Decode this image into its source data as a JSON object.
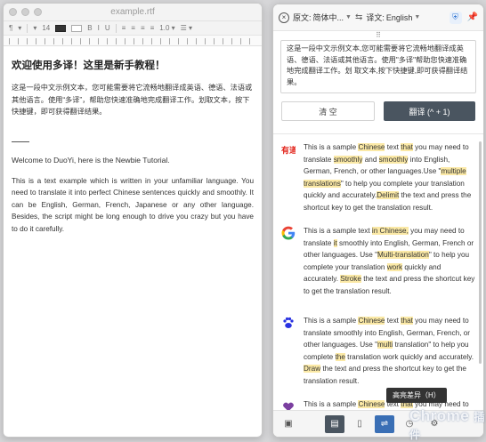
{
  "editor": {
    "filename": "example.rtf",
    "toolbar": {
      "paragraph_style": "¶",
      "font_size": "14"
    },
    "content": {
      "zh_title": "欢迎使用多译！这里是新手教程！",
      "zh_paragraph": "这是一段中文示例文本，您可能需要将它流畅地翻译成英语、德语、法语或其他语言。使用“多译”，帮助您快速准确地完成翻译工作。划取文本，按下快捷键，即可获得翻译结果。",
      "en_title": "Welcome to DuoYi, here is the Newbie Tutorial.",
      "en_paragraph": "This is a text example which is written in your unfamiliar language. You need to translate it into perfect Chinese sentences quickly and smoothly. It can be English, German, French, Japanese or any other language. Besides, the script might be long enough to drive you crazy but you have to do it carefully."
    }
  },
  "translator": {
    "source_label": "原文:",
    "source_value": "简体中...",
    "target_label": "译文:",
    "target_value": "English",
    "input_text": "这是一段中文示例文本,您可能需要将它流畅地翻译成英语、德语、法语或其他语言。使用\"多译\"帮助您快速准确地完成翻译工作。划 取文本,按下快捷键,即可获得翻译结果。",
    "clear_label": "清 空",
    "translate_label": "翻译 (^ + 1)",
    "results": [
      {
        "engine": "youdao-icon",
        "segments": [
          [
            "This is a sample ",
            false
          ],
          [
            "Chinese",
            true
          ],
          [
            " text ",
            false
          ],
          [
            "that",
            true
          ],
          [
            " you may need to translate ",
            false
          ],
          [
            "smoothly",
            true
          ],
          [
            " and ",
            false
          ],
          [
            "smoothly",
            true
          ],
          [
            " into English, German, French, or other languages.Use \"",
            false
          ],
          [
            "multiple translations",
            true
          ],
          [
            "\" to help you complete your translation quickly and accurately.",
            false
          ],
          [
            "Delimit",
            true
          ],
          [
            " the text and press the shortcut key to get the translation result.",
            false
          ]
        ]
      },
      {
        "engine": "google-icon",
        "segments": [
          [
            "This is a sample text ",
            false
          ],
          [
            "in Chinese,",
            true
          ],
          [
            " you may need to translate ",
            false
          ],
          [
            "it",
            true
          ],
          [
            " smoothly into English, German, French or other languages. Use \"",
            false
          ],
          [
            "Multi-translation",
            true
          ],
          [
            "\" to help you complete your translation ",
            false
          ],
          [
            "work",
            true
          ],
          [
            " quickly and accurately. ",
            false
          ],
          [
            "Stroke",
            true
          ],
          [
            " the text and press the shortcut key to get the translation result.",
            false
          ]
        ]
      },
      {
        "engine": "baidu-icon",
        "segments": [
          [
            "This is a sample ",
            false
          ],
          [
            "Chinese",
            true
          ],
          [
            " text ",
            false
          ],
          [
            "that",
            true
          ],
          [
            " you may need to translate smoothly into English, German, French, or other languages. Use \"",
            false
          ],
          [
            "multi",
            true
          ],
          [
            " translation\" to help you complete ",
            false
          ],
          [
            "the",
            true
          ],
          [
            " translation work quickly and accurately. ",
            false
          ],
          [
            "Draw",
            true
          ],
          [
            " the text and press the shortcut key to get the translation result.",
            false
          ]
        ]
      },
      {
        "engine": "bing-icon",
        "segments": [
          [
            "This is a sample ",
            false
          ],
          [
            "Chinese",
            true
          ],
          [
            " text ",
            false
          ],
          [
            "that",
            true
          ],
          [
            " you may need to",
            false
          ]
        ]
      }
    ],
    "tooltip": "高亮差异（H）",
    "watermark_main": "Chrome",
    "watermark_sub": "插件"
  },
  "colors": {
    "highlight": "#fbe9a6",
    "primary_button": "#4a5560",
    "youdao": "#e2231a",
    "baidu": "#2932e1"
  }
}
